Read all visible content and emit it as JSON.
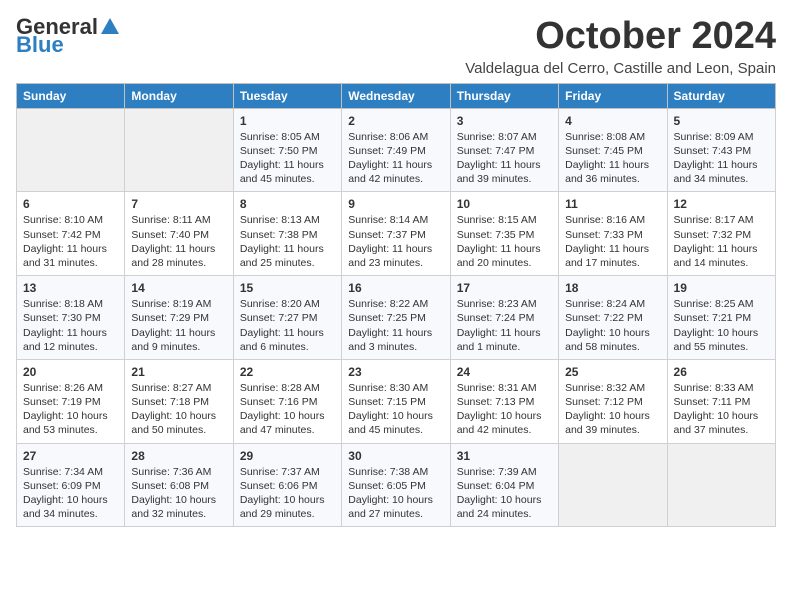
{
  "logo": {
    "general": "General",
    "blue": "Blue"
  },
  "title": "October 2024",
  "location": "Valdelagua del Cerro, Castille and Leon, Spain",
  "days_of_week": [
    "Sunday",
    "Monday",
    "Tuesday",
    "Wednesday",
    "Thursday",
    "Friday",
    "Saturday"
  ],
  "weeks": [
    [
      {
        "day": "",
        "info": ""
      },
      {
        "day": "",
        "info": ""
      },
      {
        "day": "1",
        "info": "Sunrise: 8:05 AM\nSunset: 7:50 PM\nDaylight: 11 hours and 45 minutes."
      },
      {
        "day": "2",
        "info": "Sunrise: 8:06 AM\nSunset: 7:49 PM\nDaylight: 11 hours and 42 minutes."
      },
      {
        "day": "3",
        "info": "Sunrise: 8:07 AM\nSunset: 7:47 PM\nDaylight: 11 hours and 39 minutes."
      },
      {
        "day": "4",
        "info": "Sunrise: 8:08 AM\nSunset: 7:45 PM\nDaylight: 11 hours and 36 minutes."
      },
      {
        "day": "5",
        "info": "Sunrise: 8:09 AM\nSunset: 7:43 PM\nDaylight: 11 hours and 34 minutes."
      }
    ],
    [
      {
        "day": "6",
        "info": "Sunrise: 8:10 AM\nSunset: 7:42 PM\nDaylight: 11 hours and 31 minutes."
      },
      {
        "day": "7",
        "info": "Sunrise: 8:11 AM\nSunset: 7:40 PM\nDaylight: 11 hours and 28 minutes."
      },
      {
        "day": "8",
        "info": "Sunrise: 8:13 AM\nSunset: 7:38 PM\nDaylight: 11 hours and 25 minutes."
      },
      {
        "day": "9",
        "info": "Sunrise: 8:14 AM\nSunset: 7:37 PM\nDaylight: 11 hours and 23 minutes."
      },
      {
        "day": "10",
        "info": "Sunrise: 8:15 AM\nSunset: 7:35 PM\nDaylight: 11 hours and 20 minutes."
      },
      {
        "day": "11",
        "info": "Sunrise: 8:16 AM\nSunset: 7:33 PM\nDaylight: 11 hours and 17 minutes."
      },
      {
        "day": "12",
        "info": "Sunrise: 8:17 AM\nSunset: 7:32 PM\nDaylight: 11 hours and 14 minutes."
      }
    ],
    [
      {
        "day": "13",
        "info": "Sunrise: 8:18 AM\nSunset: 7:30 PM\nDaylight: 11 hours and 12 minutes."
      },
      {
        "day": "14",
        "info": "Sunrise: 8:19 AM\nSunset: 7:29 PM\nDaylight: 11 hours and 9 minutes."
      },
      {
        "day": "15",
        "info": "Sunrise: 8:20 AM\nSunset: 7:27 PM\nDaylight: 11 hours and 6 minutes."
      },
      {
        "day": "16",
        "info": "Sunrise: 8:22 AM\nSunset: 7:25 PM\nDaylight: 11 hours and 3 minutes."
      },
      {
        "day": "17",
        "info": "Sunrise: 8:23 AM\nSunset: 7:24 PM\nDaylight: 11 hours and 1 minute."
      },
      {
        "day": "18",
        "info": "Sunrise: 8:24 AM\nSunset: 7:22 PM\nDaylight: 10 hours and 58 minutes."
      },
      {
        "day": "19",
        "info": "Sunrise: 8:25 AM\nSunset: 7:21 PM\nDaylight: 10 hours and 55 minutes."
      }
    ],
    [
      {
        "day": "20",
        "info": "Sunrise: 8:26 AM\nSunset: 7:19 PM\nDaylight: 10 hours and 53 minutes."
      },
      {
        "day": "21",
        "info": "Sunrise: 8:27 AM\nSunset: 7:18 PM\nDaylight: 10 hours and 50 minutes."
      },
      {
        "day": "22",
        "info": "Sunrise: 8:28 AM\nSunset: 7:16 PM\nDaylight: 10 hours and 47 minutes."
      },
      {
        "day": "23",
        "info": "Sunrise: 8:30 AM\nSunset: 7:15 PM\nDaylight: 10 hours and 45 minutes."
      },
      {
        "day": "24",
        "info": "Sunrise: 8:31 AM\nSunset: 7:13 PM\nDaylight: 10 hours and 42 minutes."
      },
      {
        "day": "25",
        "info": "Sunrise: 8:32 AM\nSunset: 7:12 PM\nDaylight: 10 hours and 39 minutes."
      },
      {
        "day": "26",
        "info": "Sunrise: 8:33 AM\nSunset: 7:11 PM\nDaylight: 10 hours and 37 minutes."
      }
    ],
    [
      {
        "day": "27",
        "info": "Sunrise: 7:34 AM\nSunset: 6:09 PM\nDaylight: 10 hours and 34 minutes."
      },
      {
        "day": "28",
        "info": "Sunrise: 7:36 AM\nSunset: 6:08 PM\nDaylight: 10 hours and 32 minutes."
      },
      {
        "day": "29",
        "info": "Sunrise: 7:37 AM\nSunset: 6:06 PM\nDaylight: 10 hours and 29 minutes."
      },
      {
        "day": "30",
        "info": "Sunrise: 7:38 AM\nSunset: 6:05 PM\nDaylight: 10 hours and 27 minutes."
      },
      {
        "day": "31",
        "info": "Sunrise: 7:39 AM\nSunset: 6:04 PM\nDaylight: 10 hours and 24 minutes."
      },
      {
        "day": "",
        "info": ""
      },
      {
        "day": "",
        "info": ""
      }
    ]
  ]
}
